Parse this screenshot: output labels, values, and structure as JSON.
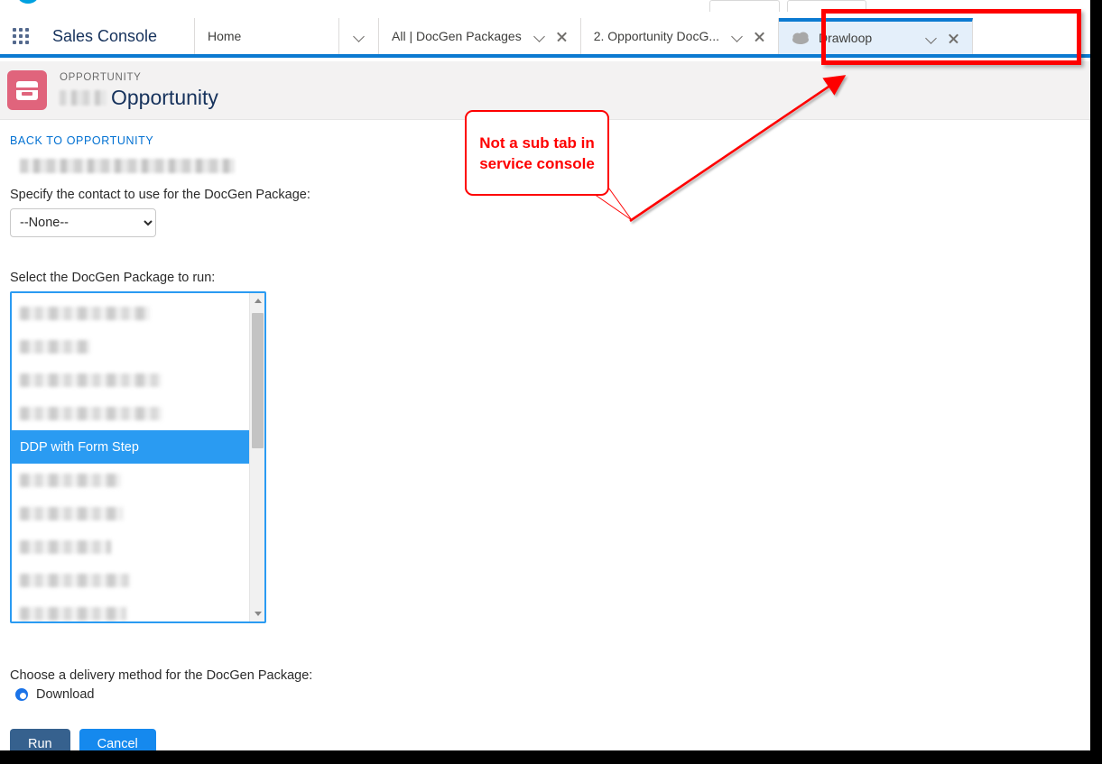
{
  "window": {
    "background_frame_color": "#000000",
    "canvas_color": "#ffffff"
  },
  "console": {
    "app_launcher_icon": "app-launcher-grid-icon",
    "app_name": "Sales Console",
    "salesforce_cloud_icon": "salesforce-cloud-logo",
    "accent_color": "#0b7ad1",
    "tabs": [
      {
        "label": "Home",
        "has_caret": false,
        "has_close": false,
        "active": false
      },
      {
        "label": "",
        "has_caret": true,
        "has_close": false,
        "active": false,
        "caret_only": true
      },
      {
        "label": "All | DocGen Packages",
        "has_caret": true,
        "has_close": true,
        "active": false
      },
      {
        "label": "2. Opportunity DocG...",
        "has_caret": true,
        "has_close": true,
        "active": false
      },
      {
        "label": "Drawloop",
        "has_caret": true,
        "has_close": true,
        "active": true,
        "icon": "cloud-icon"
      }
    ]
  },
  "record_header": {
    "icon": "opportunity-icon",
    "icon_color": "#e0647c",
    "eyebrow": "OPPORTUNITY",
    "title_blurred": true,
    "title": "Opportunity"
  },
  "main": {
    "back_link": "BACK TO OPPORTUNITY",
    "blurred_record_name": "",
    "contact_field": {
      "label": "Specify the contact to use for the DocGen Package:",
      "value": "--None--",
      "options": [
        "--None--"
      ]
    },
    "package_field": {
      "label": "Select the DocGen Package to run:",
      "selected_option": "DDP with Form Step",
      "options": [
        {
          "label": "",
          "blurred": true,
          "blur_width": 144
        },
        {
          "label": "",
          "blurred": true,
          "blur_width": 78
        },
        {
          "label": "",
          "blurred": true,
          "blur_width": 157
        },
        {
          "label": "",
          "blurred": true,
          "blur_width": 158
        },
        {
          "label": "DDP with Form Step",
          "blurred": false,
          "blur_width": 0
        },
        {
          "label": "",
          "blurred": true,
          "blur_width": 112
        },
        {
          "label": "",
          "blurred": true,
          "blur_width": 114
        },
        {
          "label": "",
          "blurred": true,
          "blur_width": 101
        },
        {
          "label": "",
          "blurred": true,
          "blur_width": 121
        },
        {
          "label": "",
          "blurred": true,
          "blur_width": 118
        }
      ],
      "scrollbar": {
        "up_arrow": "scroll-up-arrow",
        "down_arrow": "scroll-down-arrow"
      }
    },
    "delivery": {
      "label": "Choose a delivery method for the DocGen Package:",
      "selected": "Download",
      "options": [
        "Download"
      ]
    },
    "buttons": {
      "run": "Run",
      "cancel": "Cancel",
      "run_color": "#36618e",
      "cancel_color": "#1589ee"
    }
  },
  "annotations": {
    "highlight_color": "#fe0000",
    "callout_text": "Not a sub tab in service console",
    "callout_line1": "Not a sub tab",
    "callout_line2": "in service",
    "callout_line3": "console",
    "arrow": "red-arrow-pointing-to-drawloop-tab"
  }
}
